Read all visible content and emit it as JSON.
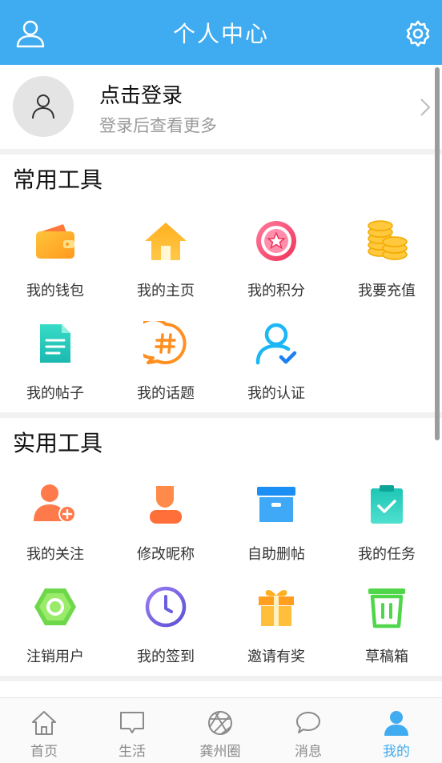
{
  "header": {
    "title": "个人中心",
    "user_icon": "user-outline-icon",
    "settings_icon": "gear-icon"
  },
  "login": {
    "title": "点击登录",
    "subtitle": "登录后查看更多"
  },
  "common_tools": {
    "title": "常用工具",
    "items": [
      {
        "label": "我的钱包",
        "icon": "wallet-icon"
      },
      {
        "label": "我的主页",
        "icon": "home-icon"
      },
      {
        "label": "我的积分",
        "icon": "star-badge-icon"
      },
      {
        "label": "我要充值",
        "icon": "coins-icon"
      },
      {
        "label": "我的帖子",
        "icon": "document-icon"
      },
      {
        "label": "我的话题",
        "icon": "hashtag-icon"
      },
      {
        "label": "我的认证",
        "icon": "verified-user-icon"
      }
    ]
  },
  "practical_tools": {
    "title": "实用工具",
    "items": [
      {
        "label": "我的关注",
        "icon": "add-user-icon"
      },
      {
        "label": "修改昵称",
        "icon": "edit-user-icon"
      },
      {
        "label": "自助删帖",
        "icon": "archive-box-icon"
      },
      {
        "label": "我的任务",
        "icon": "clipboard-check-icon"
      },
      {
        "label": "注销用户",
        "icon": "hexagon-nut-icon"
      },
      {
        "label": "我的签到",
        "icon": "clock-icon"
      },
      {
        "label": "邀请有奖",
        "icon": "gift-icon"
      },
      {
        "label": "草稿箱",
        "icon": "trash-bin-icon"
      }
    ]
  },
  "tabbar": {
    "items": [
      {
        "label": "首页",
        "icon": "home-outline-icon",
        "active": false
      },
      {
        "label": "生活",
        "icon": "message-square-icon",
        "active": false
      },
      {
        "label": "龚州圈",
        "icon": "aperture-icon",
        "active": false
      },
      {
        "label": "消息",
        "icon": "chat-bubble-icon",
        "active": false
      },
      {
        "label": "我的",
        "icon": "user-filled-icon",
        "active": true
      }
    ]
  },
  "colors": {
    "primary": "#3fabf0",
    "background": "#f1f1f1"
  }
}
